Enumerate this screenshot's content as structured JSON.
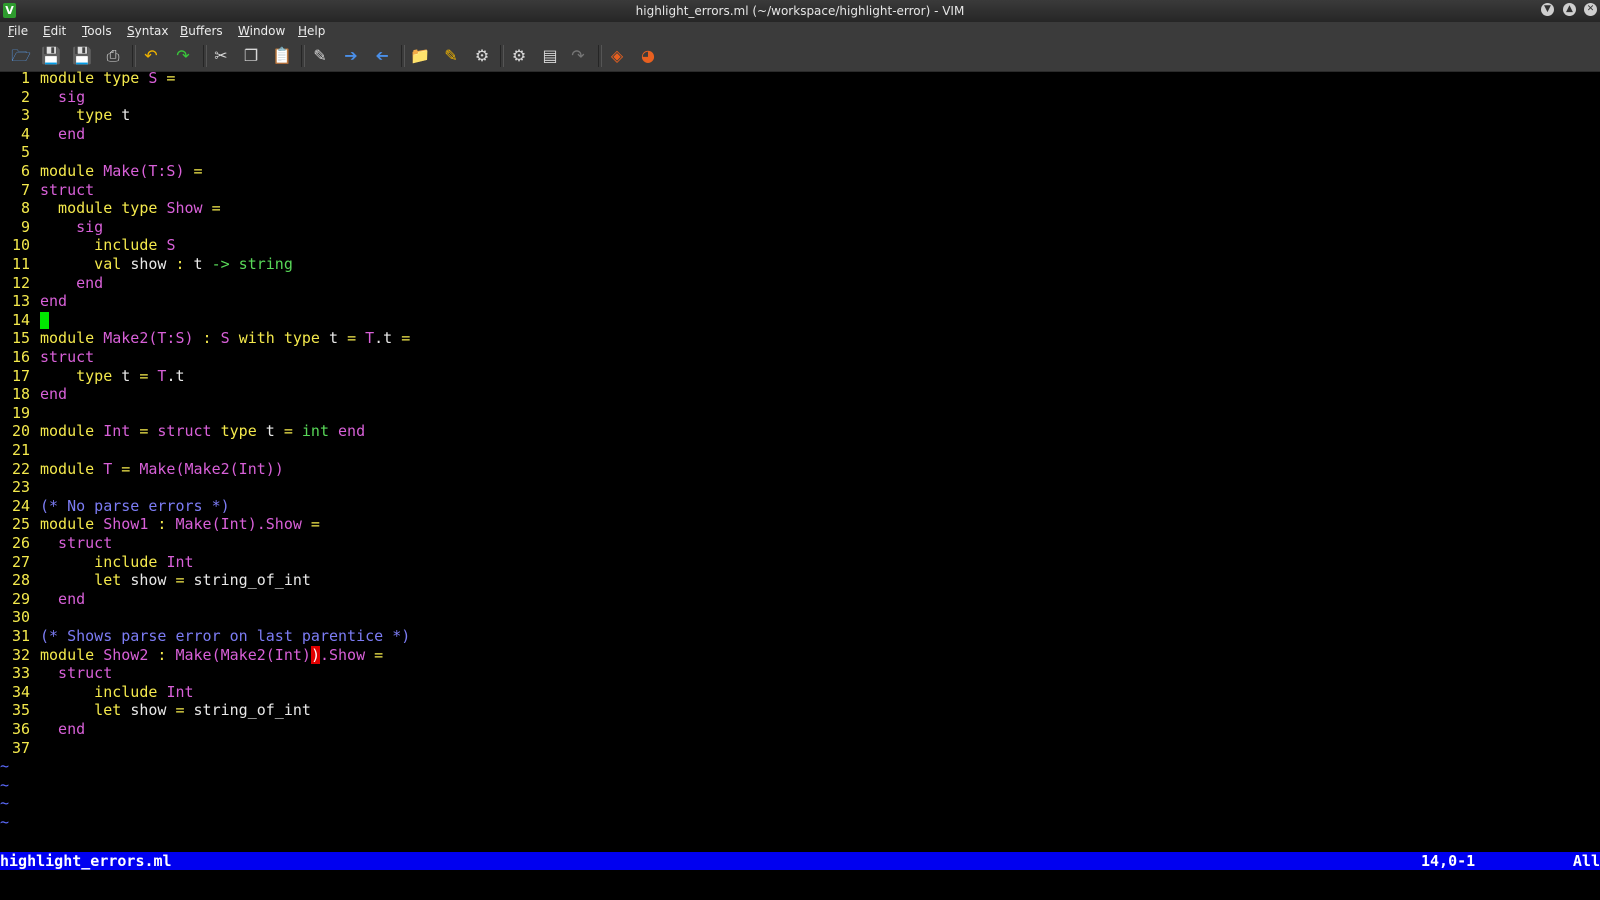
{
  "window": {
    "title": "highlight_errors.ml (~/workspace/highlight-error) - VIM"
  },
  "menu": {
    "items": [
      "File",
      "Edit",
      "Tools",
      "Syntax",
      "Buffers",
      "Window",
      "Help"
    ]
  },
  "toolbar": {
    "icons": [
      "open-icon",
      "save-icon",
      "save-all-icon",
      "print-icon",
      "undo-icon",
      "redo-icon",
      "cut-icon",
      "copy-icon",
      "paste-icon",
      "find-replace-icon",
      "forward-icon",
      "back-icon",
      "load-session-icon",
      "save-session-icon",
      "run-script-icon",
      "make-icon",
      "shell-icon",
      "tags-icon",
      "help-icon",
      "find-help-icon"
    ]
  },
  "colors": {
    "keyword": "#f4e94c",
    "identifier": "#d860d8",
    "type": "#58d858",
    "comment": "#7c7cf4",
    "error_bg": "#e00000",
    "cursor": "#00e800",
    "status_bg": "#0000f0"
  },
  "editor": {
    "lines": [
      {
        "n": "1",
        "t": [
          [
            "kw",
            "module type "
          ],
          [
            "id",
            "S"
          ],
          [
            "op",
            " ="
          ]
        ]
      },
      {
        "n": "2",
        "t": [
          [
            "id",
            "  sig"
          ]
        ]
      },
      {
        "n": "3",
        "t": [
          [
            "kw",
            "    type "
          ],
          [
            "pl",
            "t"
          ]
        ]
      },
      {
        "n": "4",
        "t": [
          [
            "id",
            "  end"
          ]
        ]
      },
      {
        "n": "5",
        "t": []
      },
      {
        "n": "6",
        "t": [
          [
            "kw",
            "module "
          ],
          [
            "id",
            "Make(T:S)"
          ],
          [
            "op",
            " ="
          ]
        ]
      },
      {
        "n": "7",
        "t": [
          [
            "id",
            "struct"
          ]
        ]
      },
      {
        "n": "8",
        "t": [
          [
            "kw",
            "  module type "
          ],
          [
            "id",
            "Show"
          ],
          [
            "op",
            " ="
          ]
        ]
      },
      {
        "n": "9",
        "t": [
          [
            "id",
            "    sig"
          ]
        ]
      },
      {
        "n": "10",
        "t": [
          [
            "kw",
            "      include "
          ],
          [
            "id",
            "S"
          ]
        ]
      },
      {
        "n": "11",
        "t": [
          [
            "kw",
            "      val "
          ],
          [
            "pl",
            "show "
          ],
          [
            "op",
            ": "
          ],
          [
            "pl",
            "t "
          ],
          [
            "ty",
            "-> string"
          ]
        ]
      },
      {
        "n": "12",
        "t": [
          [
            "id",
            "    end"
          ]
        ]
      },
      {
        "n": "13",
        "t": [
          [
            "id",
            "end"
          ]
        ]
      },
      {
        "n": "14",
        "t": [
          [
            "cursor",
            ""
          ]
        ]
      },
      {
        "n": "15",
        "t": [
          [
            "kw",
            "module "
          ],
          [
            "id",
            "Make2(T:S)"
          ],
          [
            "op",
            " : "
          ],
          [
            "id",
            "S "
          ],
          [
            "kw",
            "with type "
          ],
          [
            "pl",
            "t "
          ],
          [
            "op",
            "= "
          ],
          [
            "id",
            "T"
          ],
          [
            "pl",
            ".t"
          ],
          [
            "op",
            " ="
          ]
        ]
      },
      {
        "n": "16",
        "t": [
          [
            "id",
            "struct"
          ]
        ]
      },
      {
        "n": "17",
        "t": [
          [
            "kw",
            "    type "
          ],
          [
            "pl",
            "t "
          ],
          [
            "op",
            "= "
          ],
          [
            "id",
            "T"
          ],
          [
            "pl",
            ".t"
          ]
        ]
      },
      {
        "n": "18",
        "t": [
          [
            "id",
            "end"
          ]
        ]
      },
      {
        "n": "19",
        "t": []
      },
      {
        "n": "20",
        "t": [
          [
            "kw",
            "module "
          ],
          [
            "id",
            "Int"
          ],
          [
            "op",
            " = "
          ],
          [
            "id",
            "struct "
          ],
          [
            "kw",
            "type "
          ],
          [
            "pl",
            "t "
          ],
          [
            "op",
            "= "
          ],
          [
            "ty",
            "int "
          ],
          [
            "id",
            "end"
          ]
        ]
      },
      {
        "n": "21",
        "t": []
      },
      {
        "n": "22",
        "t": [
          [
            "kw",
            "module "
          ],
          [
            "id",
            "T"
          ],
          [
            "op",
            " = "
          ],
          [
            "id",
            "Make(Make2(Int))"
          ]
        ]
      },
      {
        "n": "23",
        "t": []
      },
      {
        "n": "24",
        "t": [
          [
            "cm",
            "(* No parse errors *)"
          ]
        ]
      },
      {
        "n": "25",
        "t": [
          [
            "kw",
            "module "
          ],
          [
            "id",
            "Show1"
          ],
          [
            "op",
            " : "
          ],
          [
            "id",
            "Make(Int).Show"
          ],
          [
            "op",
            " ="
          ]
        ]
      },
      {
        "n": "26",
        "t": [
          [
            "id",
            "  struct"
          ]
        ]
      },
      {
        "n": "27",
        "t": [
          [
            "kw",
            "      include "
          ],
          [
            "id",
            "Int"
          ]
        ]
      },
      {
        "n": "28",
        "t": [
          [
            "kw",
            "      let "
          ],
          [
            "pl",
            "show "
          ],
          [
            "op",
            "= "
          ],
          [
            "pl",
            "string_of_int"
          ]
        ]
      },
      {
        "n": "29",
        "t": [
          [
            "id",
            "  end"
          ]
        ]
      },
      {
        "n": "30",
        "t": []
      },
      {
        "n": "31",
        "t": [
          [
            "cm",
            "(* Shows parse error on last parentice *)"
          ]
        ]
      },
      {
        "n": "32",
        "t": [
          [
            "kw",
            "module "
          ],
          [
            "id",
            "Show2"
          ],
          [
            "op",
            " : "
          ],
          [
            "id",
            "Make(Make2(Int)"
          ],
          [
            "err",
            ")"
          ],
          [
            "id",
            ".Show"
          ],
          [
            "op",
            " ="
          ]
        ]
      },
      {
        "n": "33",
        "t": [
          [
            "id",
            "  struct"
          ]
        ]
      },
      {
        "n": "34",
        "t": [
          [
            "kw",
            "      include "
          ],
          [
            "id",
            "Int"
          ]
        ]
      },
      {
        "n": "35",
        "t": [
          [
            "kw",
            "      let "
          ],
          [
            "pl",
            "show "
          ],
          [
            "op",
            "= "
          ],
          [
            "pl",
            "string_of_int"
          ]
        ]
      },
      {
        "n": "36",
        "t": [
          [
            "id",
            "  end"
          ]
        ]
      },
      {
        "n": "37",
        "t": []
      }
    ],
    "tildes": [
      "~",
      "~",
      "~",
      "~"
    ]
  },
  "status": {
    "filename": "highlight_errors.ml",
    "position": "14,0-1",
    "scroll": "All"
  }
}
